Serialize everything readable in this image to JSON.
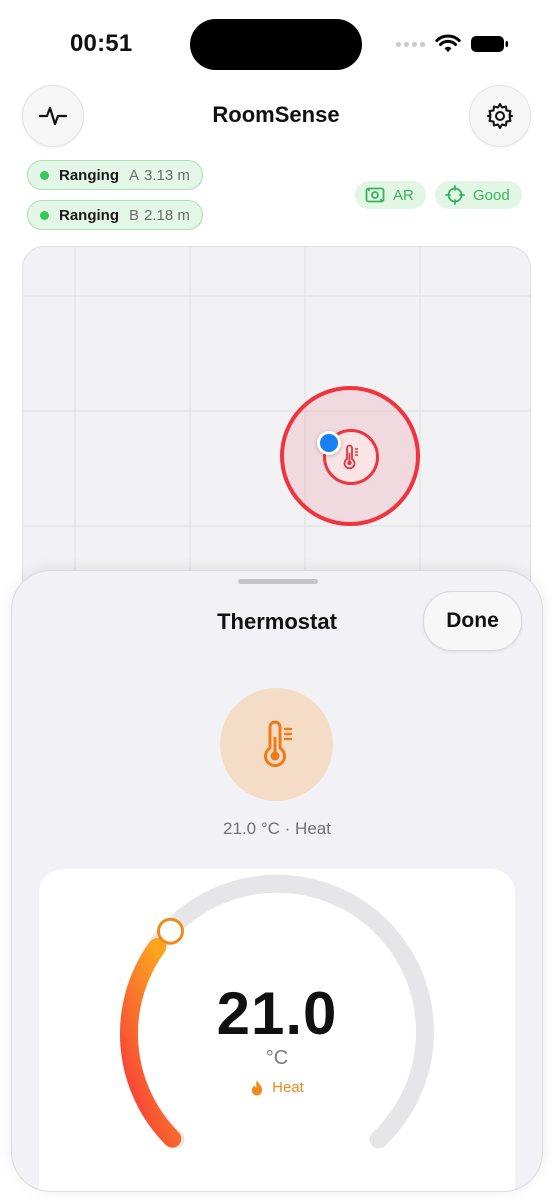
{
  "status_bar": {
    "time": "00:51"
  },
  "header": {
    "title": "RoomSense"
  },
  "ranging": [
    {
      "label": "Ranging",
      "anchor": "A",
      "distance": "3.13 m"
    },
    {
      "label": "Ranging",
      "anchor": "B",
      "distance": "2.18 m"
    }
  ],
  "badges": {
    "ar": "AR",
    "quality": "Good"
  },
  "colors": {
    "accent_green": "#35c759",
    "alert_red": "#f0343f",
    "heat_orange": "#f28a1a",
    "user_blue": "#1a7ff0"
  },
  "sheet": {
    "title": "Thermostat",
    "done_label": "Done",
    "summary": "21.0 °C · Heat",
    "temperature": "21.0",
    "unit": "°C",
    "mode": "Heat",
    "dial_fraction": 0.3
  },
  "icons": {
    "activity": "waveform-icon",
    "settings": "gear-icon",
    "device": "thermometer-icon",
    "mode": "flame-icon"
  }
}
